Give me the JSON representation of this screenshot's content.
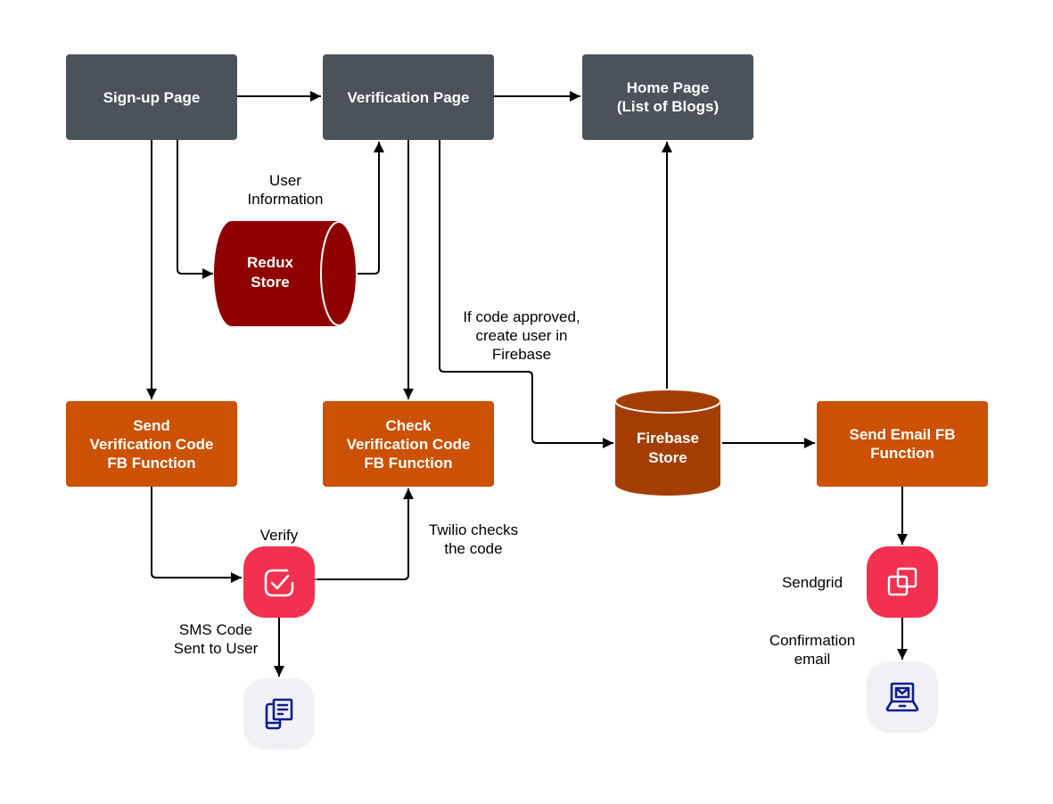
{
  "colors": {
    "page_box": "#4b525c",
    "function_box": "#cc5100",
    "redux_store": "#900000",
    "firebase_store": "#a33e00",
    "service_tile": "#f2304f",
    "endpoint_tile": "#f1f1f5",
    "endpoint_icon": "#0b1f8f",
    "connector": "#000000"
  },
  "nodes": {
    "signup_page": "Sign-up Page",
    "verification_page": "Verification Page",
    "home_page": "Home Page\n(List of Blogs)",
    "redux_store": [
      "Redux",
      "Store"
    ],
    "firebase_store": [
      "Firebase",
      "Store"
    ],
    "send_code_fn": "Send\nVerification Code\nFB Function",
    "check_code_fn": "Check\nVerification Code\nFB Function",
    "send_email_fn": "Send Email FB\nFunction"
  },
  "services": {
    "verify": {
      "label": "Verify",
      "icon": "check-square-icon"
    },
    "sendgrid": {
      "label": "Sendgrid",
      "icon": "overlapping-squares-icon"
    },
    "sms_device": {
      "icon": "phone-message-icon"
    },
    "email_device": {
      "icon": "laptop-mail-icon"
    }
  },
  "edge_labels": {
    "user_information": "User\nInformation",
    "code_approved": "If code approved,\ncreate user in\nFirebase",
    "twilio_checks": "Twilio checks\nthe code",
    "sms_sent": "SMS Code\nSent to User",
    "confirmation_email": "Confirmation\nemail"
  }
}
